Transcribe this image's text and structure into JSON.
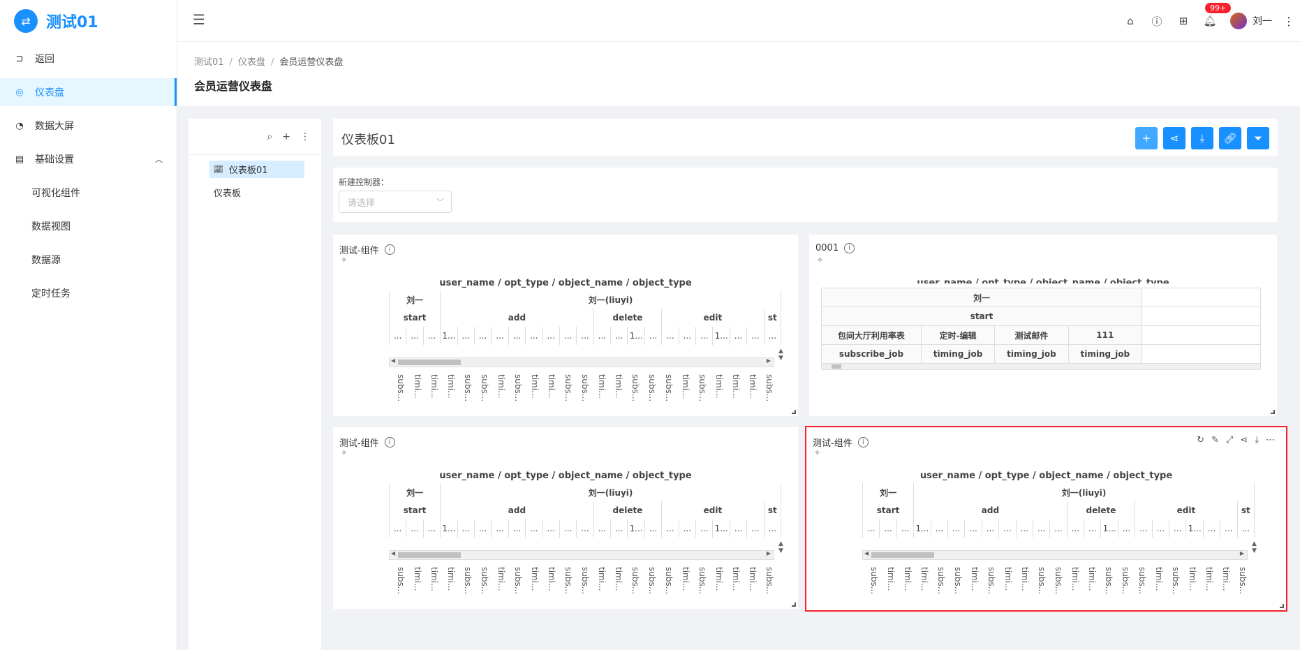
{
  "app": {
    "title": "测试01"
  },
  "sidebar": {
    "items": [
      {
        "label": "返回",
        "icon": "back-icon"
      },
      {
        "label": "仪表盘",
        "icon": "dashboard-icon",
        "active": true
      },
      {
        "label": "数据大屏",
        "icon": "pie-icon"
      },
      {
        "label": "基础设置",
        "icon": "settings-icon",
        "expanded": true
      },
      {
        "label": "可视化组件"
      },
      {
        "label": "数据视图"
      },
      {
        "label": "数据源"
      },
      {
        "label": "定时任务"
      }
    ]
  },
  "header": {
    "notification_badge": "99+",
    "user_name": "刘一"
  },
  "breadcrumb": [
    "测试01",
    "仪表盘",
    "会员运营仪表盘"
  ],
  "page_title": "会员运营仪表盘",
  "tree": {
    "nodes": [
      {
        "label": "仪表板01",
        "selected": true
      },
      {
        "label": "仪表板"
      }
    ]
  },
  "dashboard": {
    "title": "仪表板01",
    "controller_label": "新建控制器：",
    "controller_placeholder": "请选择"
  },
  "cards": [
    {
      "title": "测试-组件"
    },
    {
      "title": "0001"
    },
    {
      "title": "测试-组件"
    },
    {
      "title": "测试-组件",
      "selected": true
    }
  ],
  "pivot": {
    "title": "user_name / opt_type / object_name / object_type",
    "user_short": "刘一",
    "user_full": "刘一(liuyi)",
    "opt_start": "start",
    "opt_add": "add",
    "opt_delete": "delete",
    "opt_edit": "edit",
    "opt_st": "st",
    "ellipsis": "...",
    "one_ellipsis": "1...",
    "col_labels": [
      "subs...",
      "timi...",
      "timi...",
      "timi...",
      "subs...",
      "subs...",
      "timi...",
      "subs...",
      "timi...",
      "timi...",
      "subs...",
      "subs...",
      "timi...",
      "timi...",
      "subs...",
      "subs...",
      "subs...",
      "timi...",
      "subs...",
      "timi...",
      "timi...",
      "timi...",
      "subs..."
    ]
  },
  "table2": {
    "title": "user_name / opt_type / object_name / object_type",
    "user": "刘一",
    "opt": "start",
    "objects": [
      "包间大厅利用率表",
      "定时-编辑",
      "测试邮件",
      "111"
    ],
    "types": [
      "subscribe_job",
      "timing_job",
      "timing_job",
      "timing_job"
    ]
  }
}
